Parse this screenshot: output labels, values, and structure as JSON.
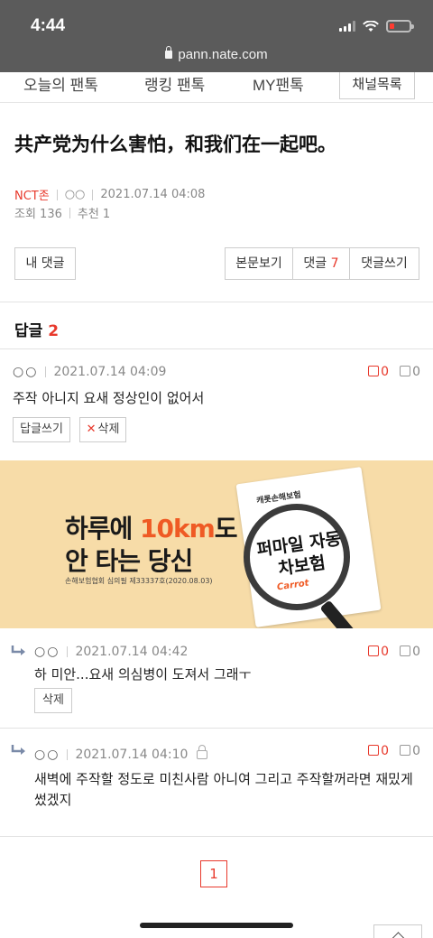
{
  "status_bar": {
    "time": "4:44"
  },
  "browser": {
    "url": "pann.nate.com"
  },
  "nav": {
    "tabs": [
      "오늘의 팬톡",
      "랭킹 팬톡",
      "MY팬톡"
    ],
    "channel_button": "채널목록"
  },
  "post": {
    "title": "共产党为什么害怕，和我们在一起吧。",
    "author": "NCT존",
    "author_sub": "○○",
    "datetime": "2021.07.14 04:08",
    "views": "조회 136",
    "recommend": "추천 1"
  },
  "actions": {
    "my_comments": "내 댓글",
    "view_body": "본문보기",
    "comments_label": "댓글",
    "comments_count": "7",
    "write_comment": "댓글쓰기"
  },
  "replies": {
    "header_label": "답글",
    "header_count": "2"
  },
  "comments": [
    {
      "name": "○○",
      "datetime": "2021.07.14 04:09",
      "up": "0",
      "down": "0",
      "text": "주작 아니지 요새 정상인이 없어서",
      "reply_button": "답글쓰기",
      "delete_button": "삭제"
    },
    {
      "name": "○○",
      "datetime": "2021.07.14 04:42",
      "up": "0",
      "down": "0",
      "text": "하 미안...요새 의심병이 도져서 그래ㅜ",
      "delete_button": "삭제"
    },
    {
      "name": "○○",
      "datetime": "2021.07.14 04:10",
      "up": "0",
      "down": "0",
      "text": "새벽에 주작할 정도로 미친사람 아니여 그리고 주작할꺼라면 재밌게썼겠지"
    }
  ],
  "ad": {
    "line1_a": "하루에 ",
    "line1_b": "10km",
    "line1_c": "도",
    "line2": "안 타는 당신",
    "fine_print": "손해보험협회 심의필 제33337호(2020.08.03)",
    "paper_title": "캐롯손해보험",
    "glass_text": "퍼마일 자동차보험",
    "brand": "Carrot"
  },
  "pagination": {
    "current": "1"
  },
  "colors": {
    "accent": "#e8392c",
    "ad_bg": "#f7dca8",
    "ad_orange": "#ef5a24",
    "topbar": "#5b5b5b"
  }
}
